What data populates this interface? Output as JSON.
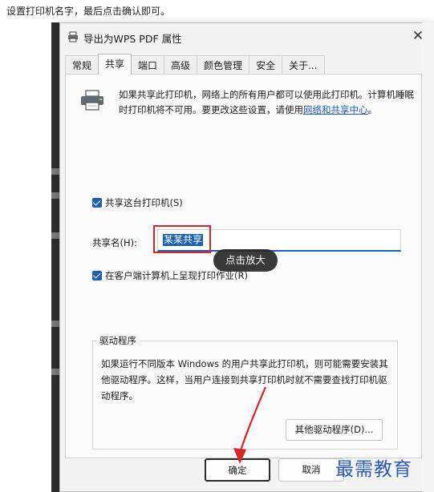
{
  "caption": "设置打印机名字，最后点击确认即可。",
  "dialog": {
    "title": "导出为WPS PDF 属性",
    "close_glyph": "✕"
  },
  "tabs": [
    {
      "label": "常规"
    },
    {
      "label": "共享",
      "active": true
    },
    {
      "label": "端口"
    },
    {
      "label": "高级"
    },
    {
      "label": "颜色管理"
    },
    {
      "label": "安全"
    },
    {
      "label": "关于..."
    }
  ],
  "intro": {
    "text": "如果共享此打印机，网络上的所有用户都可以使用此打印机。计算机睡眠时打印机将不可用。要更改这些设置，请使用",
    "link": "网络和共享中心",
    "suffix": "。"
  },
  "share_checkbox_label": "共享这台打印机(S)",
  "share_name": {
    "label": "共享名(H):",
    "value": "某某共享"
  },
  "render_checkbox_label": "在客户端计算机上呈现打印作业(R)",
  "zoom_pill": "点击放大",
  "drivers": {
    "legend": "驱动程序",
    "text": "如果运行不同版本 Windows 的用户共享此打印机，则可能需要安装其他驱动程序。这样，当用户连接到共享打印机时就不需要查找打印机驱动程序。",
    "button": "其他驱动程序(D)..."
  },
  "buttons": {
    "ok": "确定",
    "cancel": "取消"
  },
  "watermark": "最需教育",
  "colors": {
    "accent": "#1c5fad",
    "highlight_box": "#d9262c",
    "watermark": "#2a59b8"
  }
}
